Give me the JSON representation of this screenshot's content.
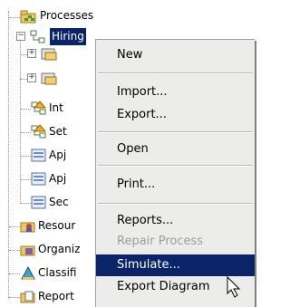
{
  "tree": {
    "root_label": "Processes",
    "hiring_label": "Hiring",
    "child_labels": [
      "Int",
      "Set",
      "Apj",
      "Apj",
      "Sec"
    ],
    "bottom_labels": [
      "Resour",
      "Organiz",
      "Classifi",
      "Report"
    ]
  },
  "menu": {
    "items": [
      {
        "label": "New",
        "state": "normal"
      },
      {
        "label": "Import...",
        "state": "normal"
      },
      {
        "label": "Export...",
        "state": "normal"
      },
      {
        "label": "Open",
        "state": "normal"
      },
      {
        "label": "Print...",
        "state": "normal"
      },
      {
        "label": "Reports...",
        "state": "normal"
      },
      {
        "label": "Repair Process",
        "state": "disabled"
      },
      {
        "label": "Simulate...",
        "state": "selected"
      },
      {
        "label": "Export Diagram",
        "state": "normal"
      }
    ]
  },
  "colors": {
    "selection": "#0a246a",
    "menu_bg": "#ececea",
    "disabled_text": "#9c9c9c"
  }
}
